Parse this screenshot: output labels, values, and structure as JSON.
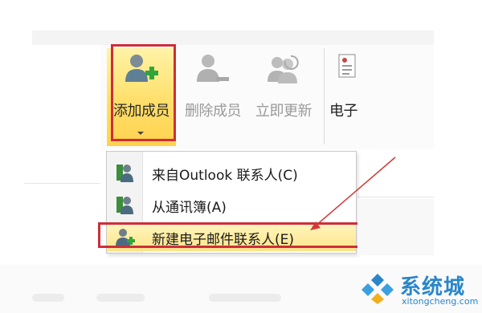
{
  "ribbon": {
    "add_member": {
      "label": "添加成员",
      "icon": "add-contact-icon",
      "state": "highlighted"
    },
    "delete_member": {
      "label": "删除成员",
      "icon": "remove-contact-icon",
      "state": "disabled"
    },
    "update_now": {
      "label": "立即更新",
      "icon": "update-contacts-icon",
      "state": "disabled"
    },
    "email": {
      "label": "电子",
      "icon": "email-card-icon"
    }
  },
  "menu": {
    "items": [
      {
        "label": "来自Outlook 联系人(C)",
        "icon": "outlook-contacts-icon"
      },
      {
        "label": "从通讯簿(A)",
        "icon": "address-book-icon"
      },
      {
        "label": "新建电子邮件联系人(E)",
        "icon": "new-email-contact-icon",
        "highlighted": true
      }
    ]
  },
  "watermark": {
    "name": "系统城",
    "site": "xitongcheng.com"
  },
  "colors": {
    "highlight_box": "#cf2d3a",
    "hover": "#ffe48a",
    "watermark": "#2a86c9"
  }
}
